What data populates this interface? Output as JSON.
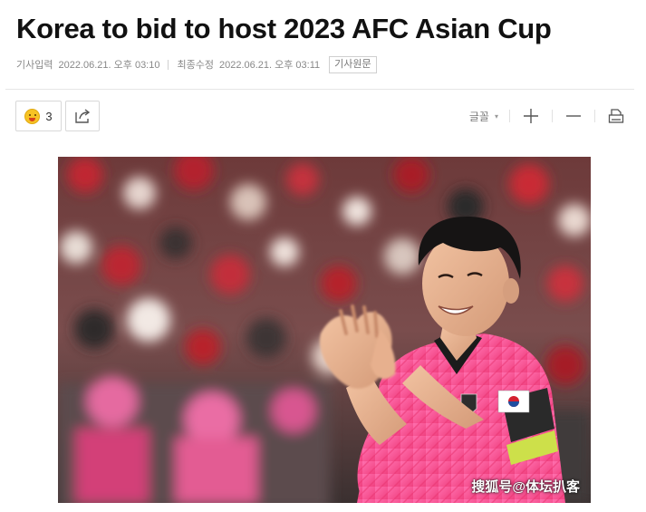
{
  "article": {
    "headline": "Korea to bid to host 2023 AFC Asian Cup",
    "published_label": "기사입력",
    "published_at": "2022.06.21. 오후 03:10",
    "updated_label": "최종수정",
    "updated_at": "2022.06.21. 오후 03:11",
    "original_button": "기사원문"
  },
  "actions": {
    "reaction_count": "3",
    "reaction_icon": "laughing-face-icon",
    "share_icon": "share-icon"
  },
  "toolbar": {
    "font_label": "글꼴",
    "font_caret": "▾",
    "zoom_in_icon": "plus-icon",
    "zoom_out_icon": "minus-icon",
    "print_icon": "print-icon"
  },
  "photo": {
    "watermark": "搜狐号@体坛扒客"
  },
  "colors": {
    "jersey": "#ff4f98",
    "crowd_red": "#b81e2a",
    "reaction_yellow": "#f7c325"
  }
}
